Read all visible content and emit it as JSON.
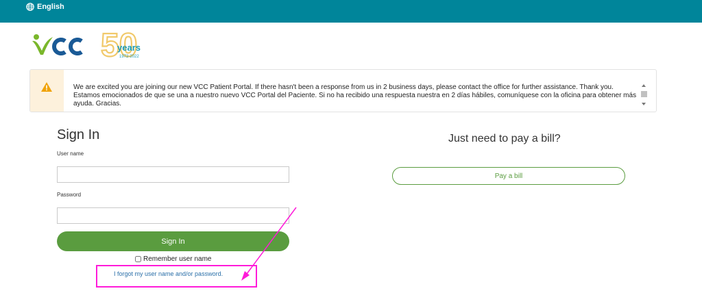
{
  "topbar": {
    "language_label": "English"
  },
  "logo": {
    "brand": "VCC",
    "anniversary_number": "50",
    "anniversary_word": "years",
    "anniversary_range": "1972-2022"
  },
  "alert": {
    "line_en": "We are excited you are joining our new VCC Patient Portal. If there hasn't been a response from us in 2 business days, please contact the office for further assistance. Thank you.",
    "line_es": "Estamos emocionados de que se una a nuestro nuevo VCC Portal del Paciente. Si no ha recibido una respuesta nuestra en 2 días hábiles, comuníquese con la oficina para obtener más ayuda. Gracias."
  },
  "signin": {
    "title": "Sign In",
    "username_label": "User name",
    "username_value": "",
    "password_label": "Password",
    "password_value": "",
    "button_label": "Sign In",
    "remember_label": "Remember user name",
    "forgot_link": "I forgot my user name and/or password."
  },
  "pay": {
    "title": "Just need to pay a bill?",
    "button_label": "Pay a bill"
  },
  "colors": {
    "topbar": "#00859a",
    "primary_green": "#5a9c3f",
    "logo_green": "#7ab72b",
    "logo_blue": "#1a5a96",
    "anniversary_gold": "#f1c96a",
    "annotation_magenta": "#ff1ad9",
    "warning": "#f0a30a"
  },
  "icons": {
    "language": "globe-icon",
    "alert": "warning-icon",
    "annotation": "arrow-annotation"
  }
}
